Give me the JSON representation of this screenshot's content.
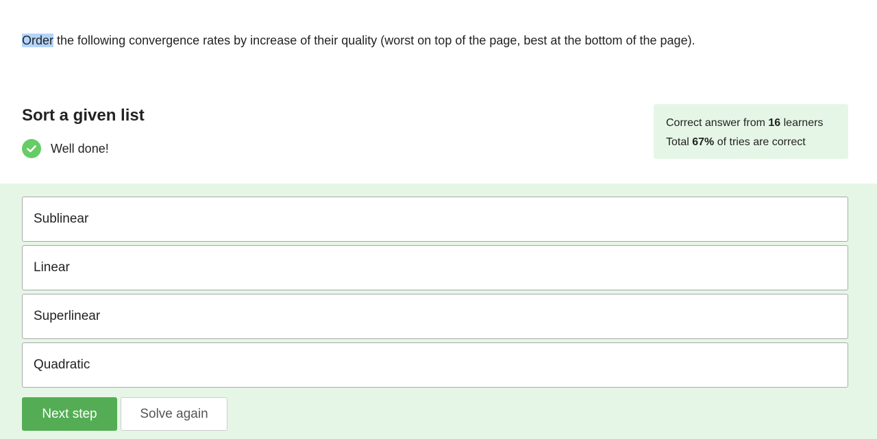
{
  "question": {
    "highlighted_word": "Order",
    "rest": " the following convergence rates by increase of their quality (worst on top of the page, best at the bottom of the page)."
  },
  "section_title": "Sort a given list",
  "status": {
    "icon": "checkmark-icon",
    "text": "Well done!",
    "color": "#66cc66"
  },
  "stats": {
    "line1_prefix": "Correct answer from ",
    "line1_count": "16",
    "line1_suffix": " learners",
    "line2_prefix": "Total ",
    "line2_percent": "67%",
    "line2_suffix": " of tries are correct"
  },
  "options": [
    "Sublinear",
    "Linear",
    "Superlinear",
    "Quadratic"
  ],
  "buttons": {
    "next_step": "Next step",
    "solve_again": "Solve again"
  },
  "colors": {
    "accent": "#54ad54",
    "answer_background": "#e6f6e6"
  }
}
